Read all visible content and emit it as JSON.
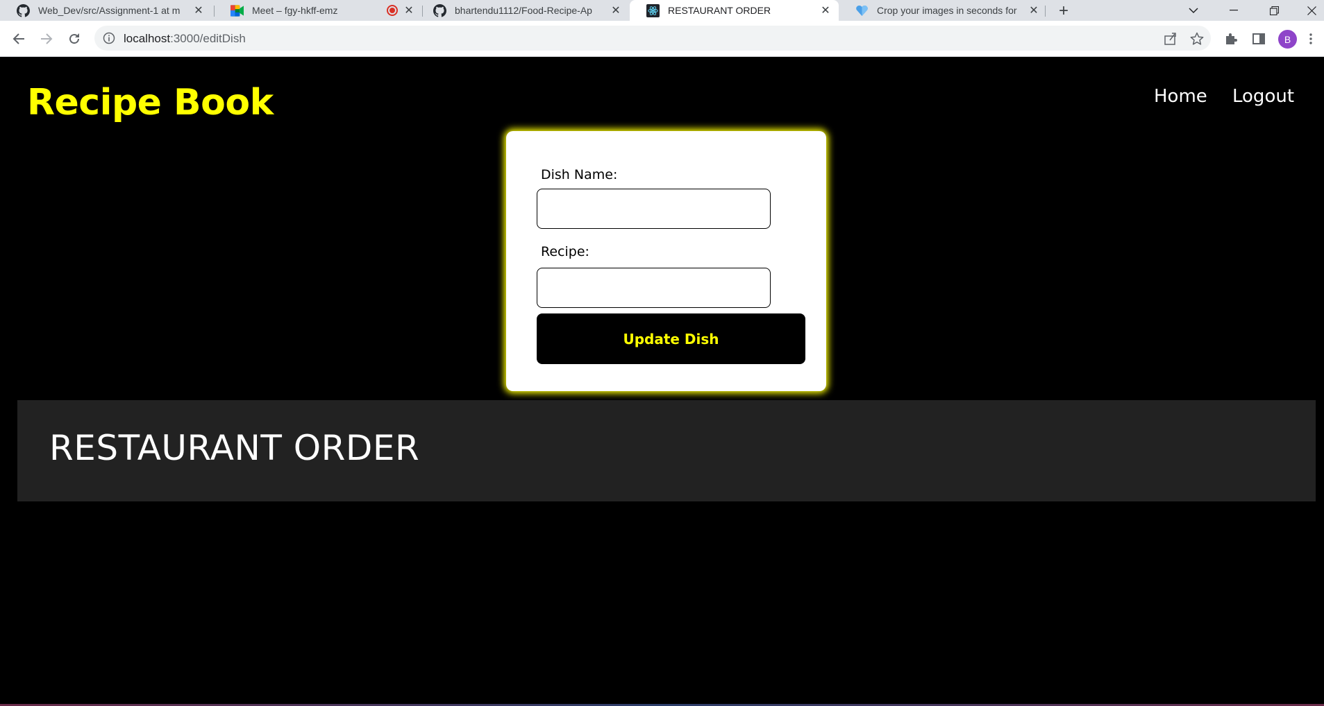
{
  "browser": {
    "tabs": [
      {
        "title": "Web_Dev/src/Assignment-1 at m",
        "favicon": "github-icon",
        "active": false
      },
      {
        "title": "Meet – fgy-hkff-emz",
        "favicon": "google-meet-icon",
        "active": false,
        "recording": true
      },
      {
        "title": "bhartendu1112/Food-Recipe-Ap",
        "favicon": "github-icon",
        "active": false
      },
      {
        "title": "RESTAURANT ORDER",
        "favicon": "react-icon",
        "active": true
      },
      {
        "title": "Crop your images in seconds for",
        "favicon": "heart-icon",
        "active": false
      }
    ],
    "url_host": "localhost",
    "url_path": ":3000/editDish",
    "profile_initial": "B"
  },
  "header": {
    "brand": "Recipe Book",
    "nav": [
      "Home",
      "Logout"
    ]
  },
  "form": {
    "dish_label": "Dish Name:",
    "dish_value": "",
    "recipe_label": "Recipe:",
    "recipe_value": "",
    "submit_label": "Update Dish"
  },
  "footer": {
    "title": "RESTAURANT ORDER"
  },
  "colors": {
    "accent": "#ffff00",
    "background": "#000000",
    "footer_bg": "#222222",
    "card_bg": "#ffffff"
  }
}
